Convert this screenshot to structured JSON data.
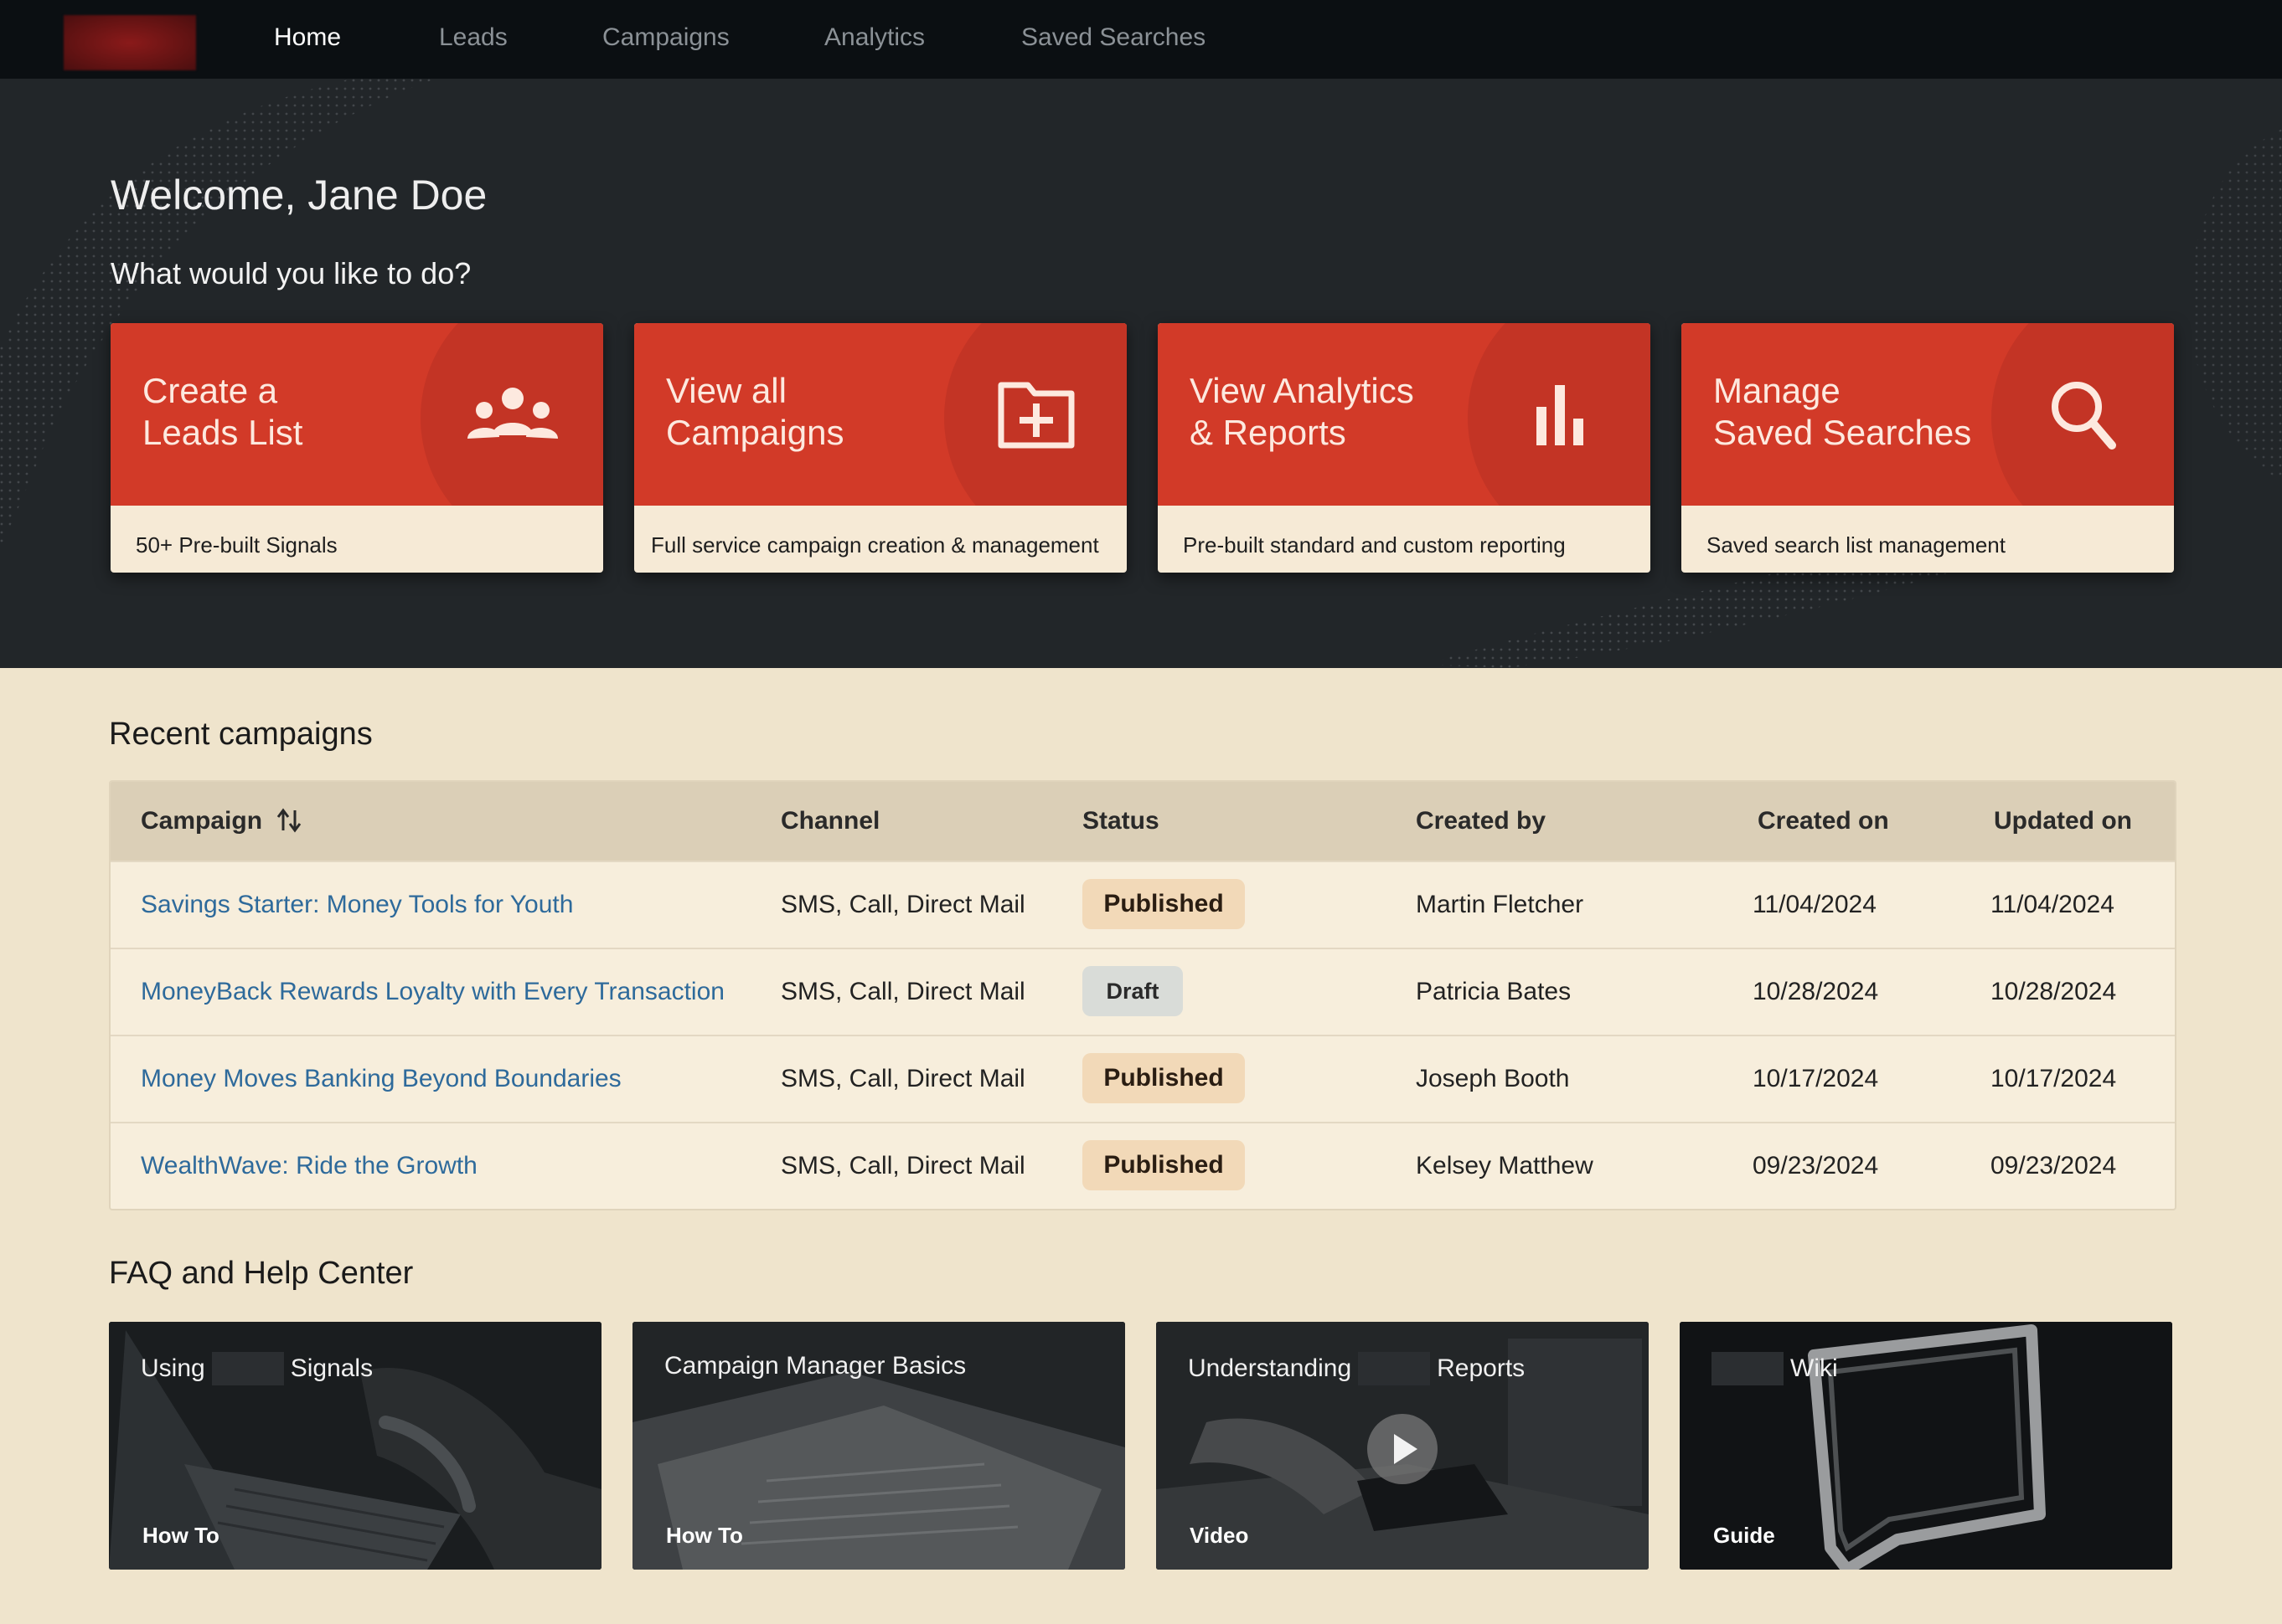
{
  "nav": {
    "items": [
      {
        "label": "Home",
        "active": true
      },
      {
        "label": "Leads"
      },
      {
        "label": "Campaigns"
      },
      {
        "label": "Analytics"
      },
      {
        "label": "Saved Searches"
      }
    ]
  },
  "hero": {
    "welcome": "Welcome, Jane Doe",
    "prompt": "What would you like to do?",
    "cards": [
      {
        "title": "Create a\nLeads List",
        "subtitle": "50+ Pre-built Signals",
        "icon": "people-group-icon"
      },
      {
        "title": "View all\nCampaigns",
        "subtitle": "Full service campaign creation & management",
        "icon": "folder-plus-icon"
      },
      {
        "title": "View Analytics\n& Reports",
        "subtitle": "Pre-built standard and custom reporting",
        "icon": "bar-chart-icon"
      },
      {
        "title": "Manage\nSaved Searches",
        "subtitle": "Saved search list management",
        "icon": "search-icon"
      }
    ]
  },
  "campaigns": {
    "title": "Recent campaigns",
    "columns": [
      "Campaign",
      "Channel",
      "Status",
      "Created by",
      "Created on",
      "Updated on"
    ],
    "rows": [
      {
        "campaign": "Savings Starter: Money Tools for Youth",
        "channel": "SMS, Call, Direct Mail",
        "status": "Published",
        "created_by": "Martin Fletcher",
        "created_on": "11/04/2024",
        "updated_on": "11/04/2024"
      },
      {
        "campaign": "MoneyBack Rewards Loyalty with Every Transaction",
        "channel": "SMS, Call, Direct Mail",
        "status": "Draft",
        "created_by": "Patricia Bates",
        "created_on": "10/28/2024",
        "updated_on": "10/28/2024"
      },
      {
        "campaign": "Money Moves Banking Beyond Boundaries",
        "channel": "SMS, Call, Direct Mail",
        "status": "Published",
        "created_by": "Joseph Booth",
        "created_on": "10/17/2024",
        "updated_on": "10/17/2024"
      },
      {
        "campaign": "WealthWave: Ride the Growth",
        "channel": "SMS, Call, Direct Mail",
        "status": "Published",
        "created_by": "Kelsey Matthew",
        "created_on": "09/23/2024",
        "updated_on": "09/23/2024"
      }
    ]
  },
  "faq": {
    "title": "FAQ and Help Center",
    "cards": [
      {
        "title_before": "Using",
        "title_after": "Signals",
        "tag": "How To"
      },
      {
        "title_before": "Campaign Manager Basics",
        "title_after": "",
        "tag": "How To"
      },
      {
        "title_before": "Understanding",
        "title_after": "Reports",
        "tag": "Video"
      },
      {
        "title_before": "",
        "title_after": "Wiki",
        "tag": "Guide"
      }
    ]
  },
  "colors": {
    "nav_bg": "#0b0f12",
    "hero_bg": "#222629",
    "accent_red": "#d23a28",
    "page_bg": "#efe4cc",
    "link": "#2e6a9b"
  }
}
